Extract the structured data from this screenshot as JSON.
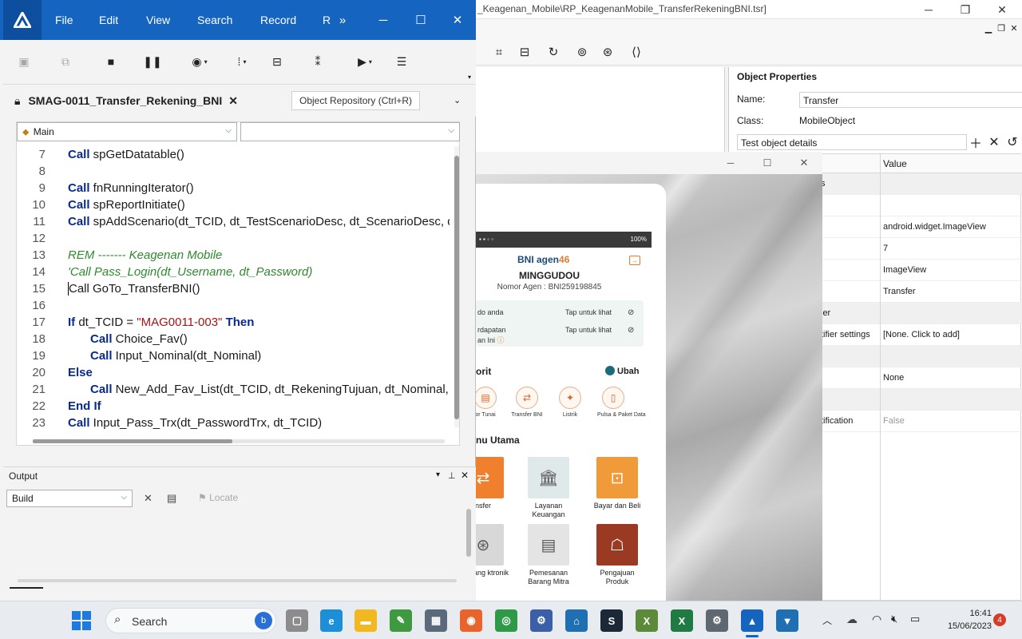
{
  "bg_window": {
    "title": "_Keagenan_Mobile\\RP_KeagenanMobile_TransferRekeningBNI.tsr]"
  },
  "object_properties": {
    "title": "Object Properties",
    "name_label": "Name:",
    "name_value": "Transfer",
    "class_label": "Class:",
    "class_value": "MobileObject",
    "details_label": "Test object details",
    "value_header": "Value",
    "rows": [
      {
        "name": "s",
        "value": "",
        "section": true
      },
      {
        "name": "",
        "value": "",
        "section": false
      },
      {
        "name": "",
        "value": "android.widget.ImageView",
        "section": false
      },
      {
        "name": "",
        "value": "7",
        "section": false
      },
      {
        "name": "",
        "value": "ImageView",
        "section": false
      },
      {
        "name": "",
        "value": "Transfer",
        "section": false
      },
      {
        "name": "ier",
        "value": "",
        "section": true
      },
      {
        "name": "tifier settings",
        "value": "[None. Click to add]",
        "section": false
      },
      {
        "name": "",
        "value": "",
        "section": true
      },
      {
        "name": "",
        "value": "None",
        "section": false
      },
      {
        "name": "",
        "value": "",
        "section": true
      },
      {
        "name": "tification",
        "value": "False",
        "section": false
      }
    ]
  },
  "mobile": {
    "brand": "BNI agen46",
    "brand_main": "BNI agen",
    "brand_num": "46",
    "status_right": "100%",
    "agent_name": "MINGGUDOU",
    "agent_no": "Nomor Agen : BNI259198845",
    "saldo_label": "do anda",
    "pendapatan_label_1": "rdapatan",
    "pendapatan_label_2": "an Ini",
    "tap_label": "Tap untuk lihat",
    "favorit_title": "orit",
    "ubah": "Ubah",
    "favorites": [
      {
        "label": "or Tunai",
        "icon": "atm-icon"
      },
      {
        "label": "Transfer BNI",
        "icon": "transfer-icon"
      },
      {
        "label": "Listrik",
        "icon": "bulb-icon"
      },
      {
        "label": "Pulsa & Paket Data",
        "icon": "phone-icon"
      }
    ],
    "menu_title": "nu Utama",
    "menu": [
      {
        "label": "nsfer",
        "color": "#f07f2e"
      },
      {
        "label": "Layanan Keuangan",
        "color": "#dfe9ea"
      },
      {
        "label": "Bayar dan Beli",
        "color": "#f09a3a"
      },
      {
        "label": "Vp Uang ktronik",
        "color": "#d8d8d8"
      },
      {
        "label": "Pemesanan Barang Mitra",
        "color": "#e4e4e4"
      },
      {
        "label": "Pengajuan Produk",
        "color": "#9a3a22"
      }
    ]
  },
  "uft": {
    "menus": [
      "File",
      "Edit",
      "View",
      "Search",
      "Record",
      "R"
    ],
    "doc_tab": "SMAG-0011_Transfer_Rekening_BNI",
    "obj_repo_tooltip": "Object Repository (Ctrl+R)",
    "combo_main": "Main",
    "combo_second": "",
    "lines": [
      {
        "n": "7",
        "indent": 0,
        "tokens": [
          {
            "t": "Call",
            "c": "kw"
          },
          {
            "t": " spGetDatatable()",
            "c": ""
          }
        ]
      },
      {
        "n": "8",
        "indent": 0,
        "tokens": []
      },
      {
        "n": "9",
        "indent": 0,
        "tokens": [
          {
            "t": "Call",
            "c": "kw"
          },
          {
            "t": " fnRunningIterator()",
            "c": ""
          }
        ]
      },
      {
        "n": "10",
        "indent": 0,
        "tokens": [
          {
            "t": "Call",
            "c": "kw"
          },
          {
            "t": " spReportInitiate()",
            "c": ""
          }
        ]
      },
      {
        "n": "11",
        "indent": 0,
        "tokens": [
          {
            "t": "Call",
            "c": "kw"
          },
          {
            "t": " spAddScenario(dt_TCID, dt_TestScenarioDesc, dt_ScenarioDesc, d",
            "c": ""
          }
        ]
      },
      {
        "n": "12",
        "indent": 0,
        "tokens": []
      },
      {
        "n": "13",
        "indent": 0,
        "tokens": [
          {
            "t": "REM ------- Keagenan Mobile",
            "c": "cmt"
          }
        ]
      },
      {
        "n": "14",
        "indent": 0,
        "tokens": [
          {
            "t": "'Call Pass_Login(dt_Username, dt_Password)",
            "c": "cmt"
          }
        ]
      },
      {
        "n": "15",
        "indent": 0,
        "tokens": [
          {
            "t": "Call",
            "c": ""
          },
          {
            "t": " GoTo_TransferBNI()",
            "c": ""
          }
        ]
      },
      {
        "n": "16",
        "indent": 0,
        "tokens": []
      },
      {
        "n": "17",
        "indent": 0,
        "tokens": [
          {
            "t": "If",
            "c": "kw"
          },
          {
            "t": " dt_TCID = ",
            "c": ""
          },
          {
            "t": "\"MAG0011-003\"",
            "c": "str"
          },
          {
            "t": " ",
            "c": ""
          },
          {
            "t": "Then",
            "c": "kw"
          }
        ]
      },
      {
        "n": "18",
        "indent": 1,
        "tokens": [
          {
            "t": "Call",
            "c": "kw"
          },
          {
            "t": " Choice_Fav()",
            "c": ""
          }
        ]
      },
      {
        "n": "19",
        "indent": 1,
        "tokens": [
          {
            "t": "Call",
            "c": "kw"
          },
          {
            "t": " Input_Nominal(dt_Nominal)",
            "c": ""
          }
        ]
      },
      {
        "n": "20",
        "indent": 0,
        "tokens": [
          {
            "t": "Else",
            "c": "kw"
          }
        ]
      },
      {
        "n": "21",
        "indent": 1,
        "tokens": [
          {
            "t": "Call",
            "c": "kw"
          },
          {
            "t": " New_Add_Fav_List(dt_TCID, dt_RekeningTujuan, dt_Nominal,",
            "c": ""
          }
        ]
      },
      {
        "n": "22",
        "indent": 0,
        "tokens": [
          {
            "t": "End If",
            "c": "kw"
          }
        ]
      },
      {
        "n": "23",
        "indent": 0,
        "tokens": [
          {
            "t": "Call",
            "c": "kw"
          },
          {
            "t": " Input_Pass_Trx(dt_PasswordTrx, dt_TCID)",
            "c": ""
          }
        ]
      }
    ],
    "output": {
      "title": "Output",
      "filter": "Build",
      "locate": "Locate"
    }
  },
  "taskbar": {
    "search_placeholder": "Search",
    "time": "16:41",
    "date": "15/06/2023",
    "notifications": "4",
    "apps": [
      {
        "name": "file-explorer-icon",
        "color": "#8c8c8c",
        "glyph": "▢"
      },
      {
        "name": "edge-icon",
        "color": "#1b8fd8",
        "glyph": "e"
      },
      {
        "name": "folder-icon",
        "color": "#f2b81f",
        "glyph": "▬"
      },
      {
        "name": "notepad-icon",
        "color": "#3f9a3f",
        "glyph": "✎"
      },
      {
        "name": "screen-tool-icon",
        "color": "#5a6a7a",
        "glyph": "▦"
      },
      {
        "name": "firefox-icon",
        "color": "#e8642a",
        "glyph": "◉"
      },
      {
        "name": "chrome-icon",
        "color": "#2e9a47",
        "glyph": "◎"
      },
      {
        "name": "network-tool-icon",
        "color": "#3a5fa8",
        "glyph": "⚙"
      },
      {
        "name": "cloud-app-icon",
        "color": "#1f6fb2",
        "glyph": "⌂"
      },
      {
        "name": "steam-icon",
        "color": "#1b2838",
        "glyph": "S"
      },
      {
        "name": "excel-file-icon",
        "color": "#5a8a3a",
        "glyph": "X"
      },
      {
        "name": "excel-icon",
        "color": "#1f7a44",
        "glyph": "X"
      },
      {
        "name": "settings-icon",
        "color": "#5f6770",
        "glyph": "⚙"
      },
      {
        "name": "uft-taskbar-icon",
        "color": "#1565c0",
        "glyph": "▲"
      },
      {
        "name": "filter-app-icon",
        "color": "#1f6fb2",
        "glyph": "▼"
      }
    ]
  }
}
